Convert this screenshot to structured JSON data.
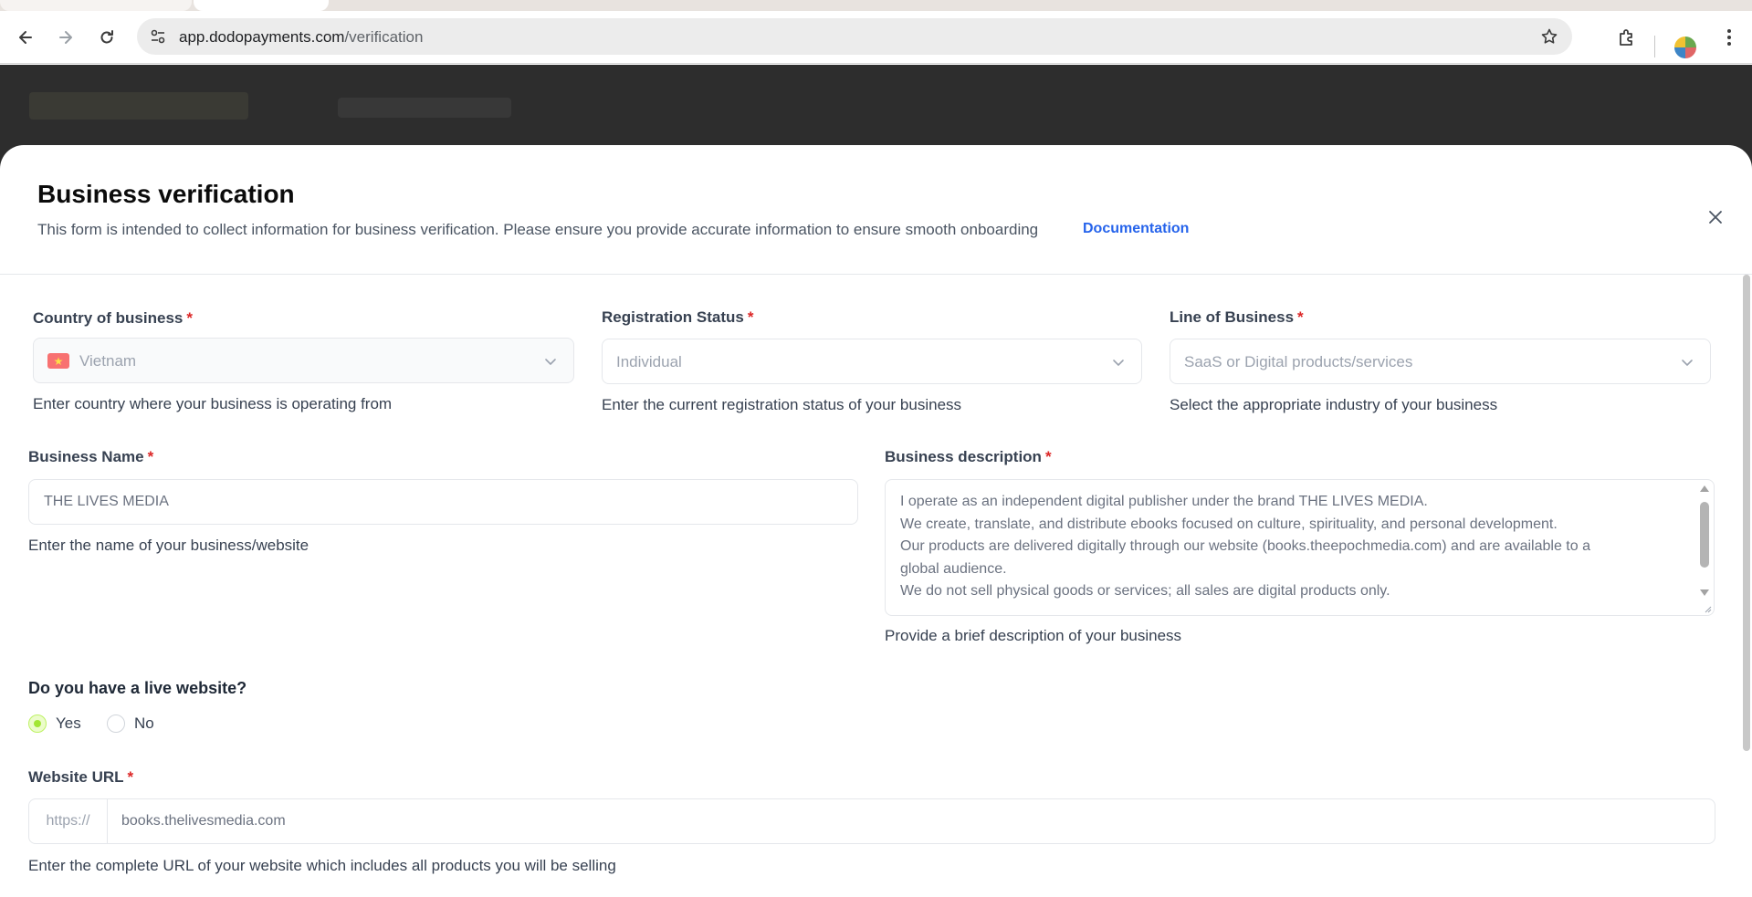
{
  "browser": {
    "url_domain": "app.dodopayments.com",
    "url_path": "/verification"
  },
  "modal": {
    "title": "Business verification",
    "subtitle": "This form is intended to collect information for business verification. Please ensure you provide accurate information to ensure smooth onboarding",
    "doc_link": "Documentation"
  },
  "form": {
    "country": {
      "label": "Country of business",
      "required": "*",
      "value": "Vietnam",
      "flag_symbol": "★",
      "help": "Enter country where your business is operating from"
    },
    "registration": {
      "label": "Registration Status",
      "required": "*",
      "value": "Individual",
      "help": "Enter the current registration status of your business"
    },
    "line_of_business": {
      "label": "Line of Business",
      "required": "*",
      "value": "SaaS or Digital products/services",
      "help": "Select the appropriate industry of your business"
    },
    "business_name": {
      "label": "Business Name",
      "required": "*",
      "value": "THE LIVES MEDIA",
      "help": "Enter the name of your business/website"
    },
    "business_description": {
      "label": "Business description",
      "required": "*",
      "lines": [
        "I operate as an independent digital publisher under the brand THE LIVES MEDIA.",
        "We create, translate, and distribute ebooks focused on culture, spirituality, and personal development.",
        "Our products are delivered digitally through our website (books.theepochmedia.com) and are available to a",
        "global audience.",
        "We do not sell physical goods or services; all sales are digital products only."
      ],
      "help": "Provide a brief description of your business"
    },
    "live_website": {
      "question": "Do you have a live website?",
      "options": [
        "Yes",
        "No"
      ],
      "selected": "Yes"
    },
    "website_url": {
      "label": "Website URL",
      "required": "*",
      "prefix": "https://",
      "value": "books.thelivesmedia.com",
      "help": "Enter the complete URL of your website which includes all products you will be selling"
    }
  }
}
